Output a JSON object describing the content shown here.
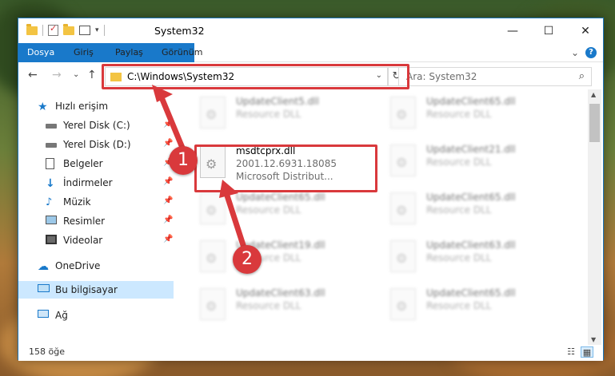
{
  "window": {
    "title": "System32",
    "minimize": "—",
    "maximize": "☐",
    "close": "✕"
  },
  "ribbon": {
    "tabs": [
      "Dosya",
      "Giriş",
      "Paylaş",
      "Görünüm"
    ],
    "expand": "⌄",
    "help": "?"
  },
  "nav": {
    "back": "←",
    "forward": "→",
    "recent": "⌄",
    "up": "↑",
    "address": "C:\\Windows\\System32",
    "address_dropdown": "⌄",
    "refresh": "↻",
    "search_placeholder": "Ara: System32",
    "search_icon": "⌕"
  },
  "sidebar": {
    "items": [
      {
        "label": "Hızlı erişim",
        "icon": "star-icon",
        "pinned": false
      },
      {
        "label": "Yerel Disk (C:)",
        "icon": "drive-icon",
        "pinned": true
      },
      {
        "label": "Yerel Disk (D:)",
        "icon": "drive-icon",
        "pinned": true
      },
      {
        "label": "Belgeler",
        "icon": "documents-icon",
        "pinned": true
      },
      {
        "label": "İndirmeler",
        "icon": "download-icon",
        "pinned": true
      },
      {
        "label": "Müzik",
        "icon": "music-icon",
        "pinned": true
      },
      {
        "label": "Resimler",
        "icon": "pictures-icon",
        "pinned": true
      },
      {
        "label": "Videolar",
        "icon": "videos-icon",
        "pinned": true
      },
      {
        "label": "OneDrive",
        "icon": "cloud-icon",
        "pinned": false
      },
      {
        "label": "Bu bilgisayar",
        "icon": "computer-icon",
        "pinned": false
      },
      {
        "label": "Ağ",
        "icon": "network-icon",
        "pinned": false
      }
    ],
    "pin_glyph": "📌"
  },
  "files": {
    "left": [
      {
        "name": "UpdateClient5.dll",
        "type": "Resource DLL"
      },
      {
        "name": "msdtcprx.dll",
        "version": "2001.12.6931.18085",
        "company": "Microsoft Distribut..."
      },
      {
        "name": "UpdateClient65.dll",
        "type": "Resource DLL"
      },
      {
        "name": "UpdateClient19.dll",
        "type": "Resource DLL"
      },
      {
        "name": "UpdateClient63.dll",
        "type": "Resource DLL"
      }
    ],
    "right": [
      {
        "name": "UpdateClient65.dll",
        "type": "Resource DLL"
      },
      {
        "name": "UpdateClient21.dll",
        "type": "Resource DLL"
      },
      {
        "name": "UpdateClient65.dll",
        "type": "Resource DLL"
      },
      {
        "name": "UpdateClient63.dll",
        "type": "Resource DLL"
      },
      {
        "name": "UpdateClient65.dll",
        "type": "Resource DLL"
      }
    ]
  },
  "status": {
    "count": "158 öğe"
  },
  "callouts": [
    "1",
    "2"
  ],
  "colors": {
    "accent": "#1979ca",
    "highlight": "#d9393c",
    "selection": "#cce8ff"
  }
}
